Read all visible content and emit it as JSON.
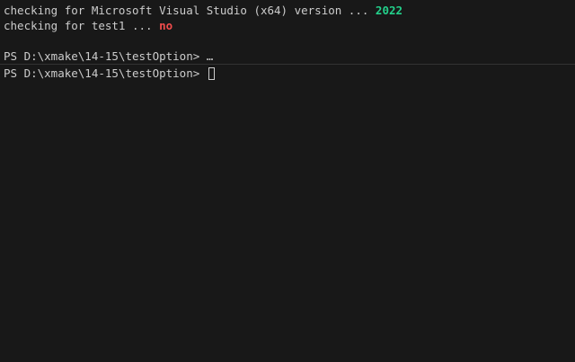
{
  "terminal": {
    "lines": [
      {
        "prefix": "checking for Microsoft Visual Studio (x64) version ... ",
        "result": "2022",
        "result_color": "#23d18b"
      },
      {
        "prefix": "checking for test1 ... ",
        "result": "no",
        "result_color": "#f14c4c"
      }
    ],
    "prompt_previous": "PS D:\\xmake\\14-15\\testOption> ",
    "prompt_previous_tail": "…",
    "prompt_current": "PS D:\\xmake\\14-15\\testOption> "
  },
  "colors": {
    "background": "#181818",
    "foreground": "#cccccc",
    "success": "#23d18b",
    "error": "#f14c4c",
    "divider": "#333333"
  }
}
